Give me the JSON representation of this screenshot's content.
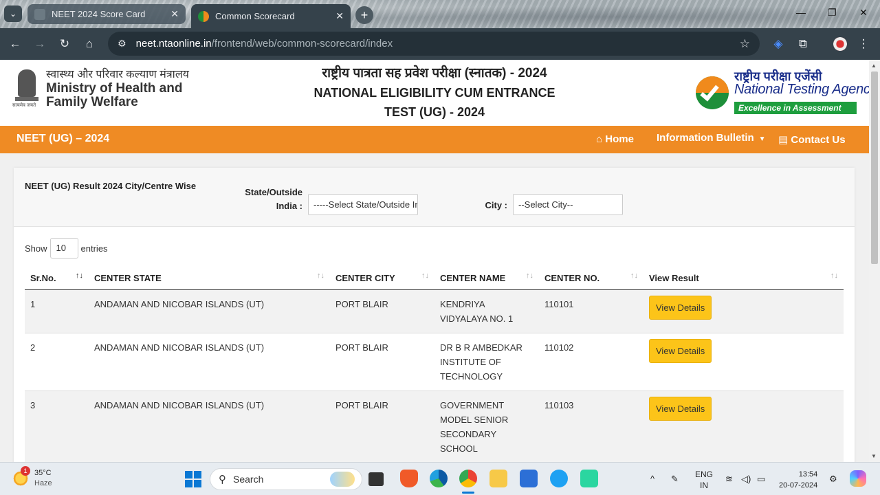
{
  "browser": {
    "tabs": [
      {
        "title": "NEET 2024 Score Card",
        "active": false
      },
      {
        "title": "Common Scorecard",
        "active": true
      }
    ],
    "url_host": "neet.ntaonline.in",
    "url_path": "/frontend/web/common-scorecard/index"
  },
  "header": {
    "mohfw_hindi": "स्वास्थ्य और परिवार कल्याण मंत्रालय",
    "mohfw_line1": "Ministry of Health and",
    "mohfw_line2": "Family Welfare",
    "emblem_motto": "सत्यमेव जयते",
    "title_hindi": "राष्ट्रीय पात्रता सह प्रवेश परीक्षा (स्नातक) - 2024",
    "title_en_line1": "NATIONAL ELIGIBILITY CUM ENTRANCE",
    "title_en_line2": "TEST (UG) - 2024",
    "nta_hindi": "राष्ट्रीय परीक्षा एजेंसी",
    "nta_en": "National Testing Agency",
    "nta_tagline": "Excellence in Assessment"
  },
  "navbar": {
    "brand": "NEET (UG) – 2024",
    "home": "Home",
    "info_bulletin": "Information Bulletin",
    "contact": "Contact Us",
    "color": "#ef8b24"
  },
  "filters": {
    "heading": "NEET (UG) Result 2024 City/Centre Wise",
    "state_label_1": "State/Outside",
    "state_label_2": "India :",
    "state_value": "-----Select State/Outside India-----",
    "city_label": "City :",
    "city_value": "--Select City--"
  },
  "table": {
    "show_label": "Show",
    "entries_value": "10",
    "entries_label": "entries",
    "columns": [
      "Sr.No.",
      "CENTER STATE",
      "CENTER CITY",
      "CENTER NAME",
      "CENTER NO.",
      "View Result"
    ],
    "button_label": "View Details",
    "rows": [
      {
        "sr": "1",
        "state": "ANDAMAN AND NICOBAR ISLANDS (UT)",
        "city": "PORT BLAIR",
        "name": "KENDRIYA VIDYALAYA NO. 1",
        "no": "110101"
      },
      {
        "sr": "2",
        "state": "ANDAMAN AND NICOBAR ISLANDS (UT)",
        "city": "PORT BLAIR",
        "name": "DR B R AMBEDKAR INSTITUTE OF TECHNOLOGY",
        "no": "110102"
      },
      {
        "sr": "3",
        "state": "ANDAMAN AND NICOBAR ISLANDS (UT)",
        "city": "PORT BLAIR",
        "name": "GOVERNMENT MODEL SENIOR SECONDARY SCHOOL",
        "no": "110103"
      }
    ]
  },
  "taskbar": {
    "temp": "35°C",
    "weather": "Haze",
    "weather_badge": "1",
    "search_placeholder": "Search",
    "lang_1": "ENG",
    "lang_2": "IN",
    "time": "13:54",
    "date": "20-07-2024"
  }
}
